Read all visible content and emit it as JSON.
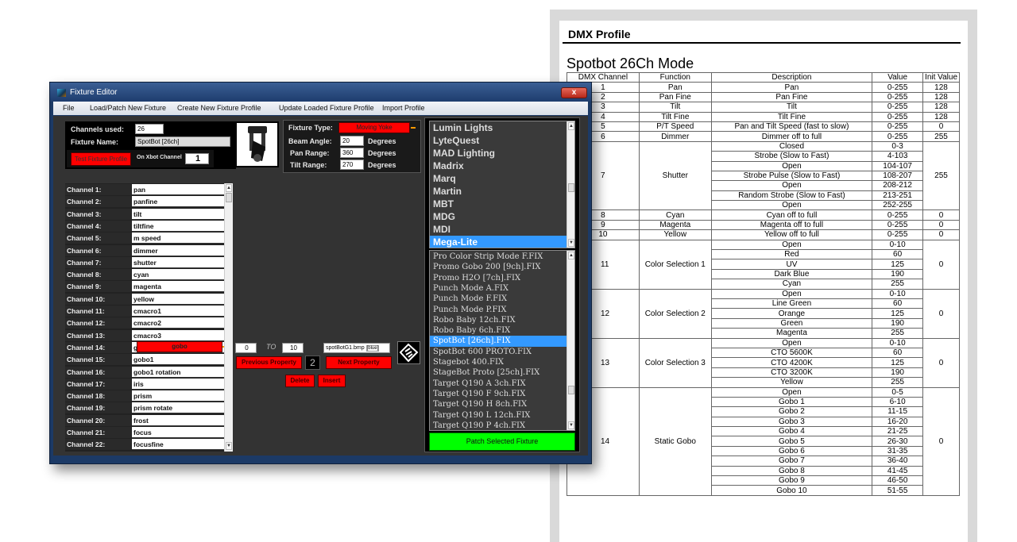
{
  "doc": {
    "heading": "DMX Profile",
    "subtitle": "Spotbot 26Ch Mode",
    "columns": [
      "DMX Channel",
      "Function",
      "Description",
      "Value",
      "Init Value"
    ],
    "groups": [
      {
        "ch": "1",
        "fn": "Pan",
        "init": "128",
        "rows": [
          [
            "Pan",
            "0-255"
          ]
        ]
      },
      {
        "ch": "2",
        "fn": "Pan Fine",
        "init": "128",
        "rows": [
          [
            "Pan Fine",
            "0-255"
          ]
        ]
      },
      {
        "ch": "3",
        "fn": "Tilt",
        "init": "128",
        "rows": [
          [
            "Tilt",
            "0-255"
          ]
        ]
      },
      {
        "ch": "4",
        "fn": "Tilt Fine",
        "init": "128",
        "rows": [
          [
            "Tilt Fine",
            "0-255"
          ]
        ]
      },
      {
        "ch": "5",
        "fn": "P/T Speed",
        "init": "0",
        "rows": [
          [
            "Pan and Tilt Speed (fast to slow)",
            "0-255"
          ]
        ]
      },
      {
        "ch": "6",
        "fn": "Dimmer",
        "init": "255",
        "rows": [
          [
            "Dimmer off to full",
            "0-255"
          ]
        ]
      },
      {
        "ch": "7",
        "fn": "Shutter",
        "init": "255",
        "rows": [
          [
            "Closed",
            "0-3"
          ],
          [
            "Strobe (Slow to Fast)",
            "4-103"
          ],
          [
            "Open",
            "104-107"
          ],
          [
            "Strobe Pulse (Slow to Fast)",
            "108-207"
          ],
          [
            "Open",
            "208-212"
          ],
          [
            "Random Strobe (Slow to Fast)",
            "213-251"
          ],
          [
            "Open",
            "252-255"
          ]
        ]
      },
      {
        "ch": "8",
        "fn": "Cyan",
        "init": "0",
        "rows": [
          [
            "Cyan off to full",
            "0-255"
          ]
        ]
      },
      {
        "ch": "9",
        "fn": "Magenta",
        "init": "0",
        "rows": [
          [
            "Magenta off to full",
            "0-255"
          ]
        ]
      },
      {
        "ch": "10",
        "fn": "Yellow",
        "init": "0",
        "rows": [
          [
            "Yellow off to full",
            "0-255"
          ]
        ]
      },
      {
        "ch": "11",
        "fn": "Color Selection 1",
        "init": "0",
        "rows": [
          [
            "Open",
            "0-10"
          ],
          [
            "Red",
            "60"
          ],
          [
            "UV",
            "125"
          ],
          [
            "Dark Blue",
            "190"
          ],
          [
            "Cyan",
            "255"
          ]
        ]
      },
      {
        "ch": "12",
        "fn": "Color Selection 2",
        "init": "0",
        "rows": [
          [
            "Open",
            "0-10"
          ],
          [
            "Line Green",
            "60"
          ],
          [
            "Orange",
            "125"
          ],
          [
            "Green",
            "190"
          ],
          [
            "Magenta",
            "255"
          ]
        ]
      },
      {
        "ch": "13",
        "fn": "Color Selection 3",
        "init": "0",
        "rows": [
          [
            "Open",
            "0-10"
          ],
          [
            "CTO 5600K",
            "60"
          ],
          [
            "CTO 4200K",
            "125"
          ],
          [
            "CTO 3200K",
            "190"
          ],
          [
            "Yellow",
            "255"
          ]
        ]
      },
      {
        "ch": "14",
        "fn": "Static Gobo",
        "init": "0",
        "rows": [
          [
            "Open",
            "0-5"
          ],
          [
            "Gobo 1",
            "6-10"
          ],
          [
            "Gobo 2",
            "11-15"
          ],
          [
            "Gobo 3",
            "16-20"
          ],
          [
            "Gobo 4",
            "21-25"
          ],
          [
            "Gobo 5",
            "26-30"
          ],
          [
            "Gobo 6",
            "31-35"
          ],
          [
            "Gobo 7",
            "36-40"
          ],
          [
            "Gobo 8",
            "41-45"
          ],
          [
            "Gobo 9",
            "46-50"
          ],
          [
            "Gobo 10",
            "51-55"
          ]
        ]
      }
    ]
  },
  "window": {
    "title": "Fixture Editor",
    "close": "x",
    "menu": [
      "File",
      "Load/Patch New Fixture",
      "Create New Fixture Profile",
      "Update Loaded Fixture Profile",
      "Import Profile"
    ],
    "info": {
      "channels_label": "Channels used:",
      "channels_value": "26",
      "name_label": "Fixture Name:",
      "name_value": "SpotBot [26ch]",
      "test_button": "Test Fixture Profile",
      "on_channel_label": "On Xbot Channel",
      "on_channel_value": "1"
    },
    "props": {
      "type_label": "Fixture Type:",
      "type_value": "Moving Yoke",
      "beam_label": "Beam Angle:",
      "beam_value": "20",
      "pan_label": "Pan Range:",
      "pan_value": "360",
      "tilt_label": "Tilt Range:",
      "tilt_value": "270",
      "unit": "Degrees"
    },
    "channels": [
      [
        "Channel 1:",
        "pan"
      ],
      [
        "Channel 2:",
        "panfine"
      ],
      [
        "Channel 3:",
        "tilt"
      ],
      [
        "Channel 4:",
        "tiltfine"
      ],
      [
        "Channel 5:",
        "m speed"
      ],
      [
        "Channel 6:",
        "dimmer"
      ],
      [
        "Channel 7:",
        "shutter"
      ],
      [
        "Channel 8:",
        "cyan"
      ],
      [
        "Channel 9:",
        "magenta"
      ],
      [
        "Channel 10:",
        "yellow"
      ],
      [
        "Channel 11:",
        "cmacro1"
      ],
      [
        "Channel 12:",
        "cmacro2"
      ],
      [
        "Channel 13:",
        "cmacro3"
      ],
      [
        "Channel 14:",
        "g"
      ],
      [
        "Channel 15:",
        "gobo1"
      ],
      [
        "Channel 16:",
        "gobo1 rotation"
      ],
      [
        "Channel 17:",
        "iris"
      ],
      [
        "Channel 18:",
        "prism"
      ],
      [
        "Channel 19:",
        "prism rotate"
      ],
      [
        "Channel 20:",
        "frost"
      ],
      [
        "Channel 21:",
        "focus"
      ],
      [
        "Channel 22:",
        "focusfine"
      ]
    ],
    "channel14_dropdown": "gobo",
    "property": {
      "from": "0",
      "to_label": "TO",
      "to": "10",
      "image_file": "spotBotG1.bmp",
      "image_button": "[blue]",
      "prev": "Previous Property",
      "index": "2",
      "next": "Next Property",
      "delete": "Delete",
      "insert": "Insert"
    },
    "manufacturers": [
      "Lumin Lights",
      "LyteQuest",
      "MAD Lighting",
      "Madrix",
      "Marq",
      "Martin",
      "MBT",
      "MDG",
      "MDI",
      "Mega-Lite"
    ],
    "manufacturer_selected": "Mega-Lite",
    "fixtures": [
      "Pro Color Strip Mode F.FIX",
      "Promo Gobo 200 [9ch].FIX",
      "Promo H2O [7ch].FIX",
      "Punch Mode A.FIX",
      "Punch Mode F.FIX",
      "Punch Mode P.FIX",
      "Robo Baby 12ch.FIX",
      "Robo Baby 6ch.FIX",
      "SpotBot [26ch].FIX",
      "SpotBot 600 PROTO.FIX",
      "Stagebot 400.FIX",
      "StageBot Proto [25ch].FIX",
      "Target Q190 A 3ch.FIX",
      "Target Q190 F 9ch.FIX",
      "Target Q190 H 8ch.FIX",
      "Target Q190 L 12ch.FIX",
      "Target Q190 P 4ch.FIX"
    ],
    "fixture_selected": "SpotBot [26ch].FIX",
    "patch_button": "Patch Selected Fixture"
  },
  "colors": {
    "red": "#ff0000",
    "green": "#00ff00",
    "selection": "#3399ff",
    "panel": "#333333"
  }
}
